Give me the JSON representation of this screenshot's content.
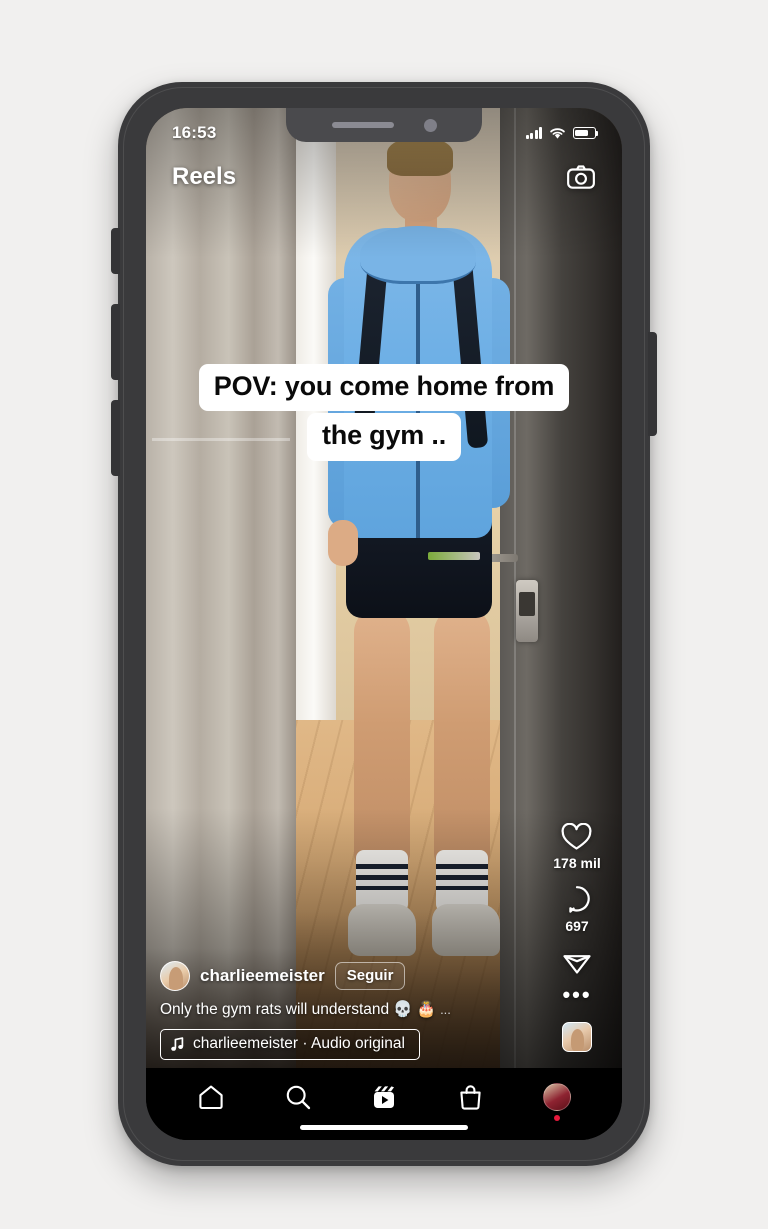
{
  "status_bar": {
    "time": "16:53",
    "signal_icon": "cellular-signal-icon",
    "wifi_icon": "wifi-icon",
    "battery_icon": "battery-icon",
    "battery_level_percent": 62
  },
  "header": {
    "title": "Reels",
    "camera_icon": "camera-icon"
  },
  "video_caption_overlay": {
    "line1": "POV: you come home from",
    "line2": "the gym .."
  },
  "action_rail": {
    "like": {
      "icon": "heart-icon",
      "count": "178 mil"
    },
    "comment": {
      "icon": "comment-bubble-icon",
      "count": "697"
    },
    "share": {
      "icon": "paper-plane-icon"
    },
    "more": {
      "icon": "ellipsis-icon",
      "label": "•••"
    },
    "audio_thumbnail": {
      "icon": "audio-thumbnail"
    }
  },
  "post_meta": {
    "avatar": "user-avatar",
    "username": "charlieemeister",
    "follow_label": "Seguir",
    "caption_text": "Only the gym rats will understand",
    "caption_emojis": "💀 🎂",
    "caption_more": "...",
    "audio": {
      "music_icon": "music-note-icon",
      "text": "charlieemeister · Audio original"
    }
  },
  "bottom_nav": {
    "items": [
      {
        "name": "home",
        "icon": "home-icon"
      },
      {
        "name": "search",
        "icon": "search-icon"
      },
      {
        "name": "reels",
        "icon": "reels-clapperboard-icon"
      },
      {
        "name": "shop",
        "icon": "shopping-bag-icon"
      },
      {
        "name": "profile",
        "icon": "profile-avatar-icon"
      }
    ]
  },
  "device": {
    "notch_speaker": "speaker-grille",
    "notch_camera": "front-camera-lens",
    "home_indicator": "home-indicator-bar",
    "buttons": [
      "silent-switch",
      "volume-up",
      "volume-down",
      "power"
    ]
  },
  "colors": {
    "page_background": "#f1f0ef",
    "phone_frame": "#3a3a3c",
    "nav_background": "#000000",
    "accent_red": "#e8193c",
    "text_white": "#ffffff",
    "caption_box": "#ffffff"
  }
}
